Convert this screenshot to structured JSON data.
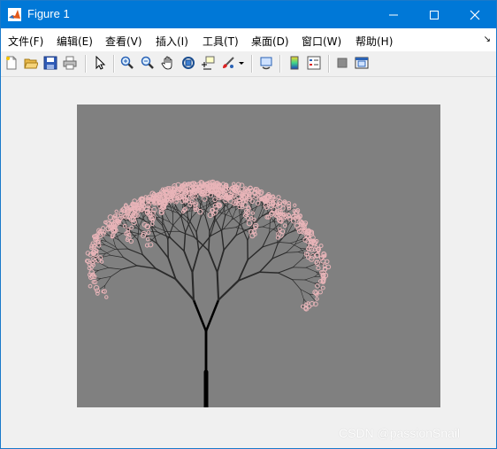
{
  "window": {
    "title": "Figure 1",
    "controls": [
      "minimize",
      "maximize",
      "close"
    ]
  },
  "menubar": {
    "items": [
      {
        "label": "文件(F)"
      },
      {
        "label": "编辑(E)"
      },
      {
        "label": "查看(V)"
      },
      {
        "label": "插入(I)"
      },
      {
        "label": "工具(T)"
      },
      {
        "label": "桌面(D)"
      },
      {
        "label": "窗口(W)"
      },
      {
        "label": "帮助(H)"
      }
    ]
  },
  "toolbar": {
    "icons": [
      "new-figure-icon",
      "open-file-icon",
      "save-icon",
      "print-icon",
      "select-arrow-icon",
      "zoom-in-icon",
      "zoom-out-icon",
      "pan-hand-icon",
      "rotate-3d-icon",
      "data-cursor-icon",
      "brush-icon",
      "link-plot-icon",
      "colorbar-icon",
      "legend-icon",
      "hide-plot-tools-icon",
      "show-plot-tools-icon"
    ]
  },
  "figure": {
    "axes_background": "#808080",
    "trunk_color": "#000000",
    "branch_color": "#2a2a2a",
    "blossom_color": "#e8b4b8",
    "recursion_depth": 9
  },
  "watermark": "CSDN @passionSnail"
}
